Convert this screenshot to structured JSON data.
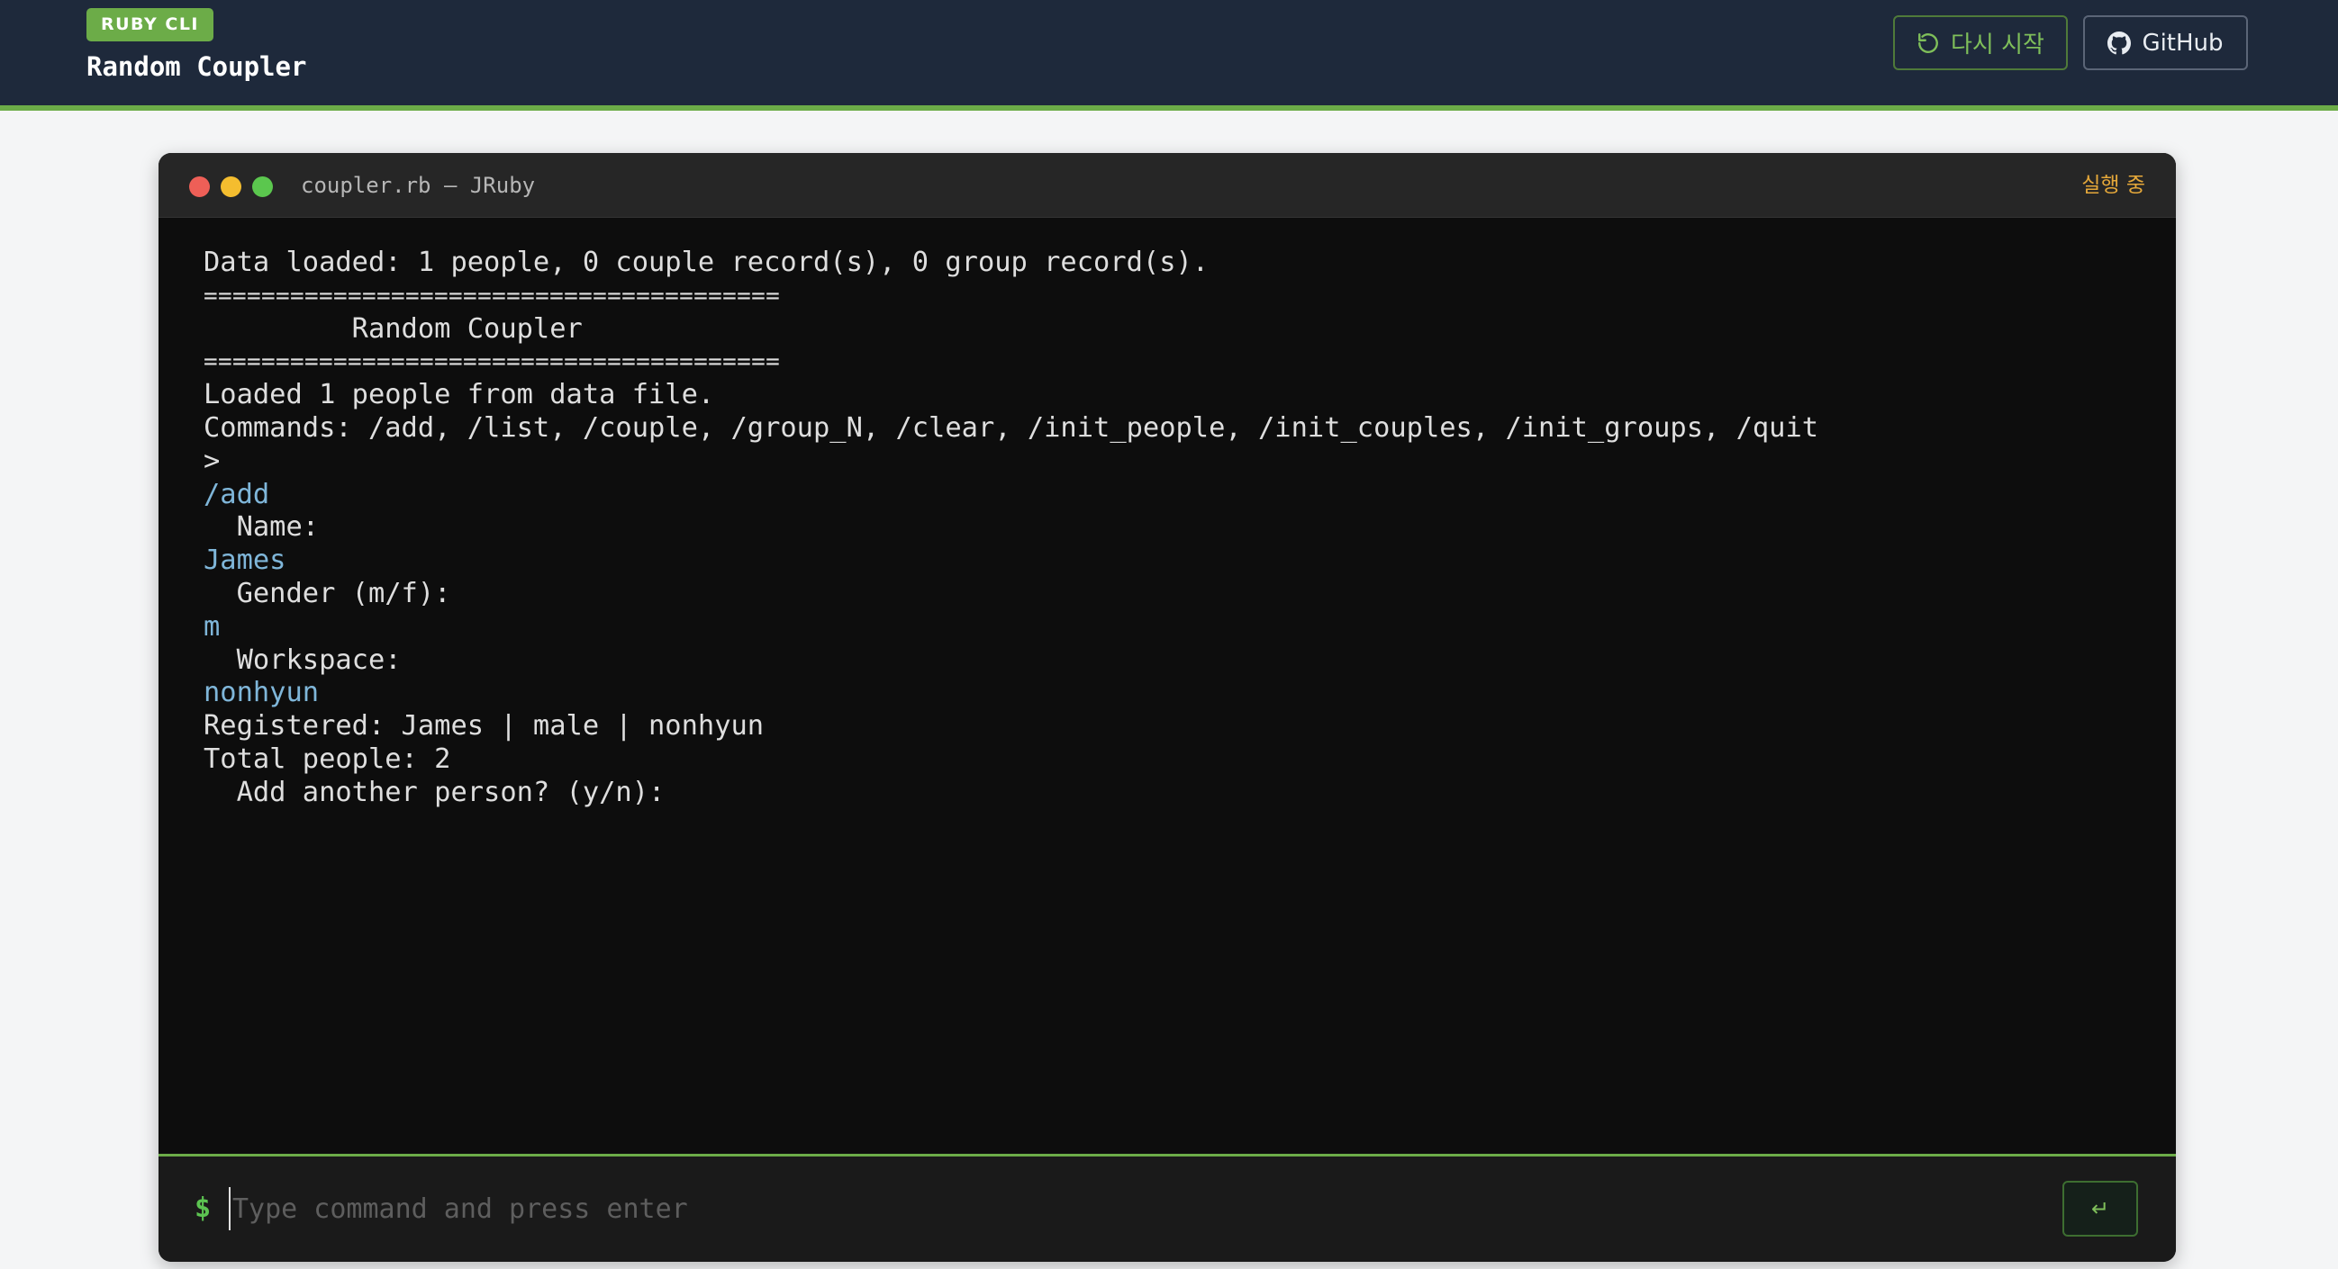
{
  "header": {
    "badge": "RUBY CLI",
    "title": "Random Coupler",
    "restart_label": "다시 시작",
    "github_label": "GitHub",
    "accent_color": "#6cac48"
  },
  "terminal": {
    "title": "coupler.rb — JRuby",
    "status": "실행 중",
    "lines": [
      {
        "text": "Data loaded: 1 people, 0 couple record(s), 0 group record(s).",
        "kind": "output"
      },
      {
        "text": "========================================",
        "kind": "eq"
      },
      {
        "text": "         Random Coupler",
        "kind": "output"
      },
      {
        "text": "========================================",
        "kind": "eq"
      },
      {
        "text": "Loaded 1 people from data file.",
        "kind": "output"
      },
      {
        "text": "Commands: /add, /list, /couple, /group_N, /clear, /init_people, /init_couples, /init_groups, /quit",
        "kind": "output"
      },
      {
        "text": ">",
        "kind": "output"
      },
      {
        "text": "/add",
        "kind": "input"
      },
      {
        "text": "  Name:",
        "kind": "output"
      },
      {
        "text": "James",
        "kind": "input"
      },
      {
        "text": "  Gender (m/f):",
        "kind": "output"
      },
      {
        "text": "m",
        "kind": "input"
      },
      {
        "text": "  Workspace:",
        "kind": "output"
      },
      {
        "text": "nonhyun",
        "kind": "input"
      },
      {
        "text": "Registered: James | male | nonhyun",
        "kind": "output"
      },
      {
        "text": "Total people: 2",
        "kind": "output"
      },
      {
        "text": "  Add another person? (y/n):",
        "kind": "output"
      }
    ],
    "prompt_symbol": "$",
    "input_placeholder": "Type command and press enter",
    "input_value": "",
    "send_label": "↵"
  }
}
